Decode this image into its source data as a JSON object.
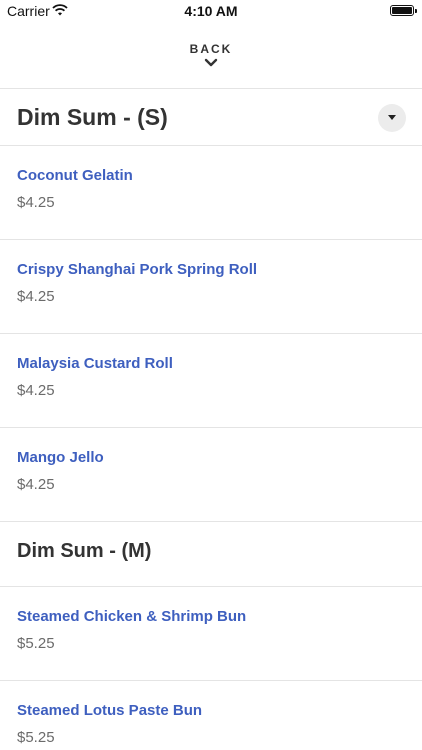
{
  "status_bar": {
    "carrier": "Carrier",
    "time": "4:10 AM",
    "battery_level": 1.0,
    "icons": [
      "wifi-icon",
      "battery-icon"
    ]
  },
  "nav": {
    "back_label": "BACK",
    "back_icon": "chevron-down-icon"
  },
  "colors": {
    "item_name": "#3e5fbf",
    "price": "#6b6b6b",
    "divider": "#e4e4e4"
  },
  "sections": [
    {
      "title": "Dim Sum - (S)",
      "has_dropdown": true,
      "items": [
        {
          "name": "Coconut Gelatin",
          "price": "$4.25"
        },
        {
          "name": "Crispy Shanghai Pork Spring Roll",
          "price": "$4.25"
        },
        {
          "name": "Malaysia Custard Roll",
          "price": "$4.25"
        },
        {
          "name": "Mango Jello",
          "price": "$4.25"
        }
      ]
    },
    {
      "title": "Dim Sum - (M)",
      "has_dropdown": false,
      "items": [
        {
          "name": "Steamed Chicken & Shrimp Bun",
          "price": "$5.25"
        },
        {
          "name": "Steamed Lotus Paste Bun",
          "price": "$5.25"
        }
      ]
    }
  ]
}
